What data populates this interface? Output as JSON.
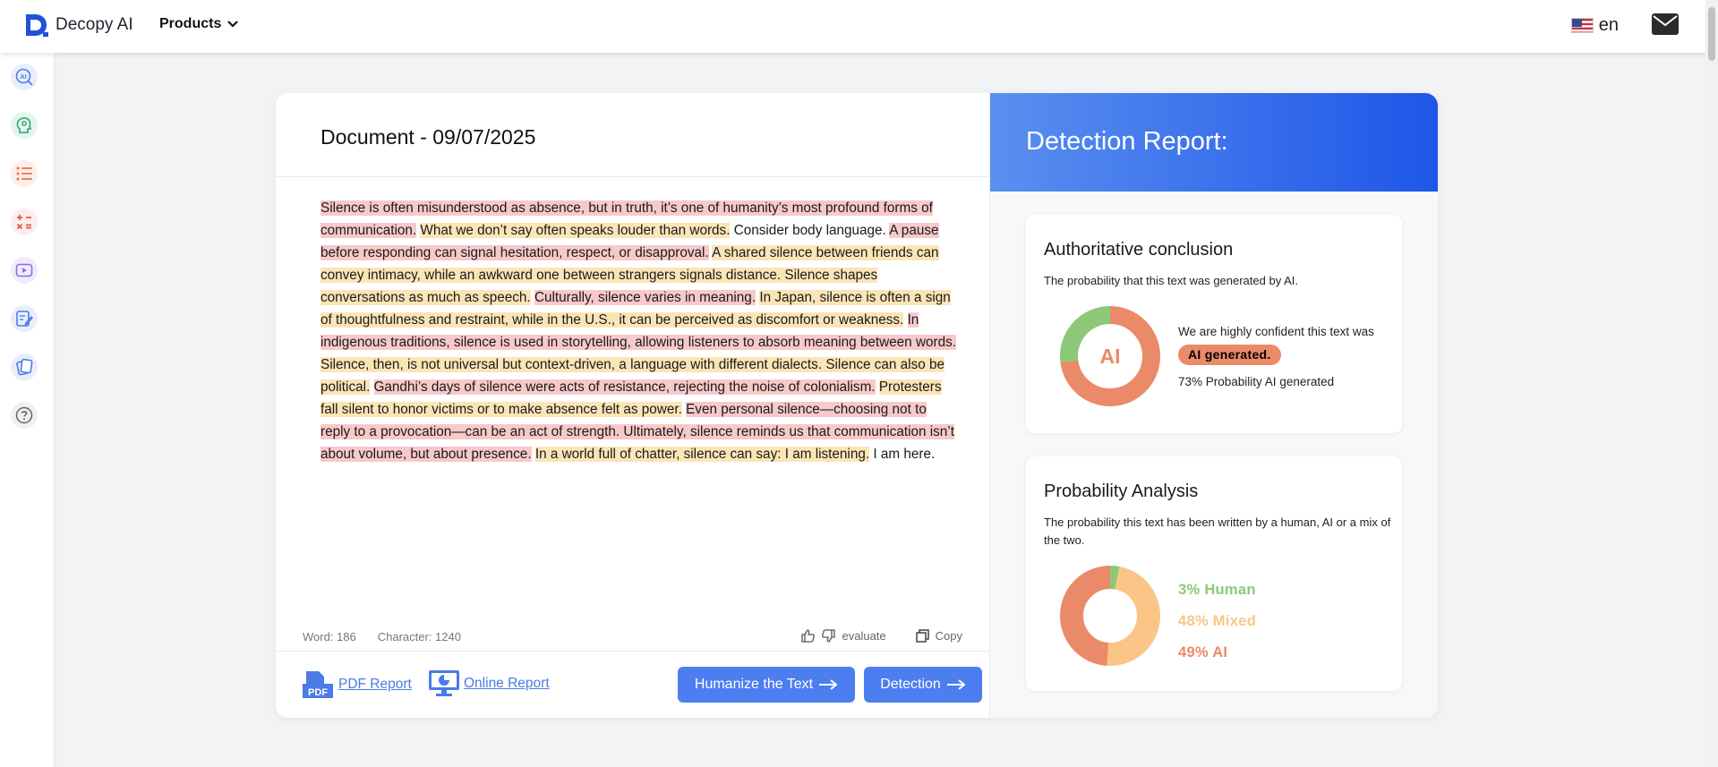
{
  "app": {
    "name": "Decopy AI",
    "products_label": "Products",
    "language": "en"
  },
  "sidebar": {
    "items": [
      {
        "icon": "ai-detector-icon",
        "color": "#4f7be8"
      },
      {
        "icon": "humanizer-icon",
        "color": "#2aa775"
      },
      {
        "icon": "list-icon",
        "color": "#ef7d5a"
      },
      {
        "icon": "math-symbols-icon",
        "color": "#e5584a"
      },
      {
        "icon": "video-icon",
        "color": "#8b6de8"
      },
      {
        "icon": "edit-note-icon",
        "color": "#4f7be8"
      },
      {
        "icon": "cards-icon",
        "color": "#4f7be8"
      },
      {
        "icon": "help-icon",
        "color": "#666666"
      }
    ]
  },
  "document": {
    "title": "Document - 09/07/2025",
    "segments": [
      {
        "text": "Silence is often misunderstood as absence, but in truth, it’s one of humanity’s most profound forms of communication.",
        "hl": "red"
      },
      {
        "text": " ",
        "hl": "none"
      },
      {
        "text": "What we don’t say often speaks louder than words.",
        "hl": "yellow"
      },
      {
        "text": " Consider body language. ",
        "hl": "none"
      },
      {
        "text": "A pause before responding can signal hesitation, respect, or disapproval.",
        "hl": "red"
      },
      {
        "text": " ",
        "hl": "none"
      },
      {
        "text": "A shared silence between friends can convey intimacy, while an awkward one between strangers signals distance. Silence shapes conversations as much as speech.",
        "hl": "yellow"
      },
      {
        "text": " ",
        "hl": "none"
      },
      {
        "text": "Culturally, silence varies in meaning.",
        "hl": "red"
      },
      {
        "text": " ",
        "hl": "none"
      },
      {
        "text": "In Japan, silence is often a sign of thoughtfulness and restraint, while in the U.S., it can be perceived as discomfort or weakness.",
        "hl": "yellow"
      },
      {
        "text": " ",
        "hl": "none"
      },
      {
        "text": "In indigenous traditions, silence is used in storytelling, allowing listeners to absorb meaning between words.",
        "hl": "red"
      },
      {
        "text": " ",
        "hl": "none"
      },
      {
        "text": "Silence, then, is not universal but context-driven, a language with different dialects. Silence can also be political.",
        "hl": "yellow"
      },
      {
        "text": " ",
        "hl": "none"
      },
      {
        "text": "Gandhi’s days of silence were acts of resistance, rejecting the noise of colonialism.",
        "hl": "red"
      },
      {
        "text": " ",
        "hl": "none"
      },
      {
        "text": "Protesters fall silent to honor victims or to make absence felt as power.",
        "hl": "yellow"
      },
      {
        "text": " ",
        "hl": "none"
      },
      {
        "text": "Even personal silence—choosing not to reply to a provocation—can be an act of strength. Ultimately, silence reminds us that communication isn’t about volume, but about presence.",
        "hl": "red"
      },
      {
        "text": " ",
        "hl": "none"
      },
      {
        "text": "In a world full of chatter, silence can say: I am listening.",
        "hl": "yellow"
      },
      {
        "text": " I am here.",
        "hl": "none"
      }
    ],
    "word_count": "Word: 186",
    "char_count": "Character: 1240",
    "evaluate_label": "evaluate",
    "copy_label": "Copy",
    "pdf_report_label": "PDF Report",
    "online_report_label": "Online Report",
    "humanize_label": "Humanize the Text",
    "detection_label": "Detection"
  },
  "report": {
    "title": "Detection Report:",
    "conclusion": {
      "title": "Authoritative conclusion",
      "subtitle": "The probability that this text was generated by AI.",
      "donut_label": "AI",
      "ai_fraction": 0.73,
      "confident_text": "We are highly confident this text was",
      "badge": "AI generated.",
      "probability_text": "73% Probability AI generated"
    },
    "analysis": {
      "title": "Probability Analysis",
      "subtitle": "The probability this text has been written by a human, AI or a mix of the two.",
      "items": [
        {
          "label": "3% Human",
          "value": 3,
          "color": "#8dc878"
        },
        {
          "label": "48% Mixed",
          "value": 48,
          "color": "#fbc588"
        },
        {
          "label": "49% AI",
          "value": 49,
          "color": "#ea8a68"
        }
      ]
    }
  },
  "colors": {
    "accent": "#4d7ef0",
    "ai": "#ea8a68",
    "human": "#8dc878",
    "mixed": "#fbc588"
  }
}
